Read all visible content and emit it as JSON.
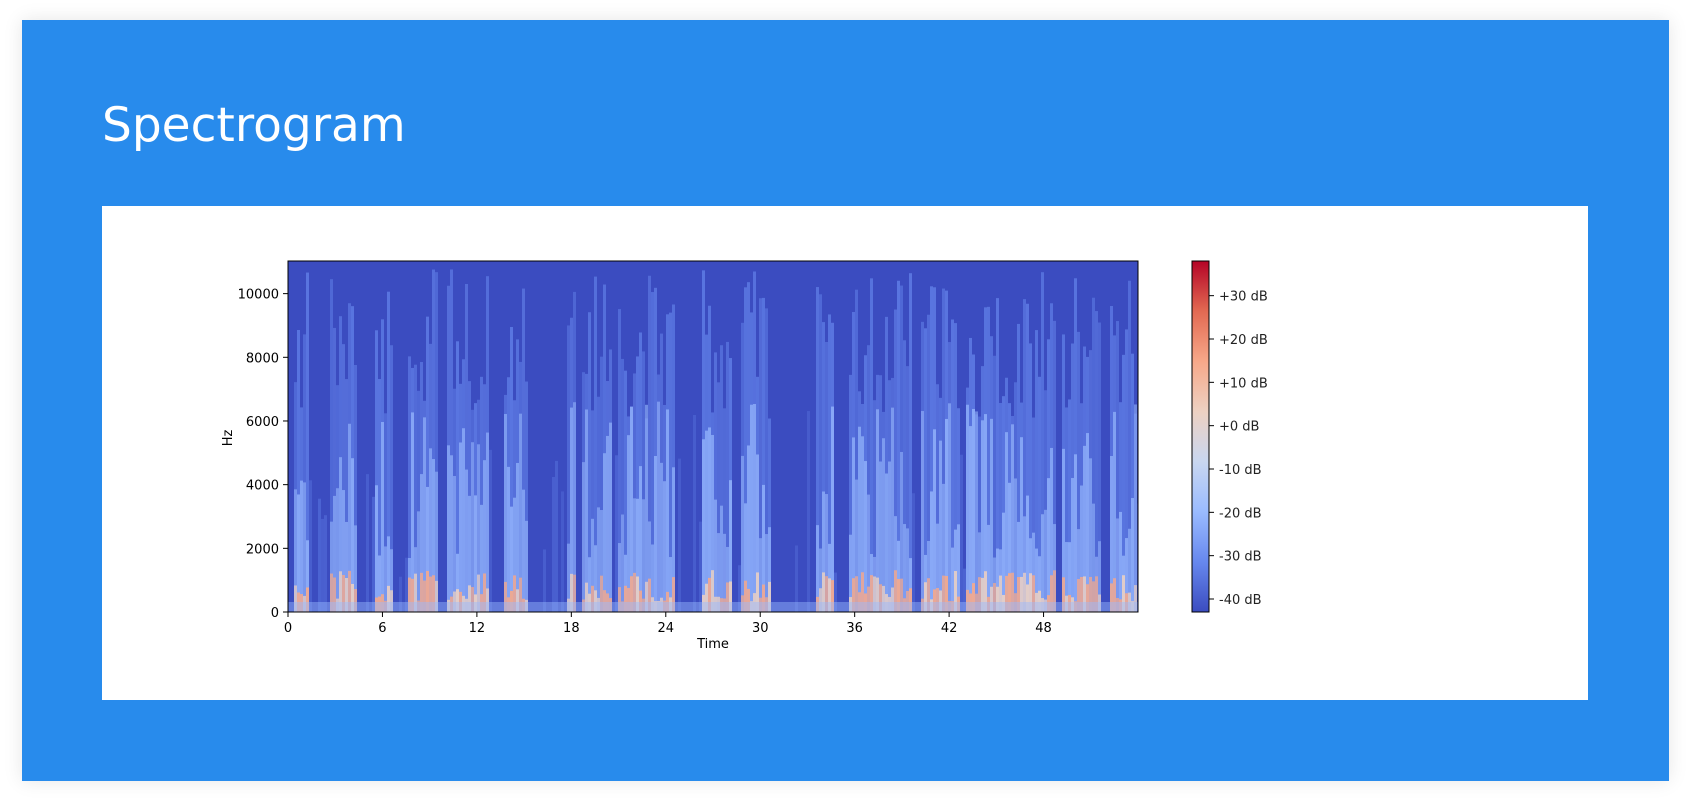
{
  "page": {
    "title": "Spectrogram"
  },
  "chart_data": {
    "type": "heatmap",
    "title": "",
    "xlabel": "Time",
    "ylabel": "Hz",
    "xlim": [
      0,
      54
    ],
    "ylim": [
      0,
      11025
    ],
    "x_ticks": [
      0,
      6,
      12,
      18,
      24,
      30,
      36,
      42,
      48
    ],
    "x_tick_labels": [
      "0",
      "6",
      "12",
      "18",
      "24",
      "30",
      "36",
      "42",
      "48"
    ],
    "y_ticks": [
      0,
      2000,
      4000,
      6000,
      8000,
      10000
    ],
    "y_tick_labels": [
      "0",
      "2000",
      "4000",
      "6000",
      "8000",
      "10000"
    ],
    "colormap": "coolwarm",
    "colorbar": {
      "range": [
        -43,
        38
      ],
      "ticks": [
        30,
        20,
        10,
        0,
        -10,
        -20,
        -30,
        -40
      ],
      "tick_labels": [
        "+30 dB",
        "+20 dB",
        "+10 dB",
        "+0 dB",
        "-10 dB",
        "-20 dB",
        "-30 dB",
        "-40 dB"
      ],
      "colors": [
        "#3b4cc0",
        "#6788ee",
        "#9abbff",
        "#c9d7f0",
        "#edd1c2",
        "#f7a889",
        "#e26952",
        "#b40426"
      ]
    },
    "background_color": "#3b4cc0",
    "grid": false
  }
}
